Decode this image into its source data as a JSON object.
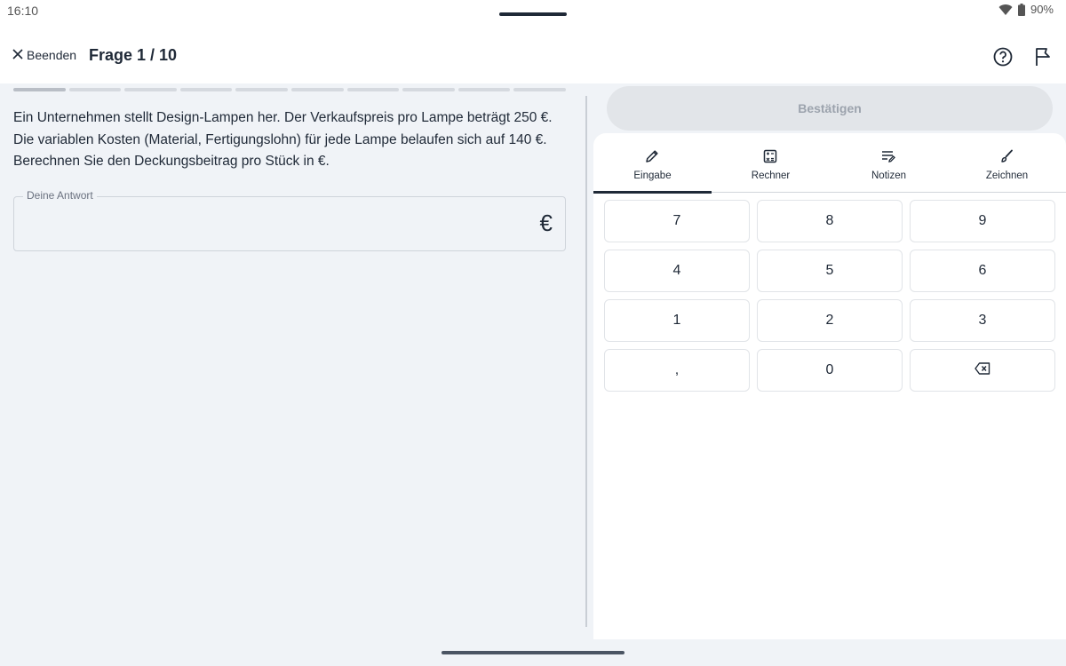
{
  "status": {
    "time": "16:10",
    "battery": "90%"
  },
  "header": {
    "close_label": "Beenden",
    "title": "Frage 1 / 10"
  },
  "progress": {
    "current": 1,
    "total": 10
  },
  "question": {
    "lines": [
      "Ein Unternehmen stellt Design-Lampen her. Der Verkaufspreis pro Lampe beträgt 250 €.",
      "Die variablen Kosten (Material, Fertigungslohn) für jede Lampe belaufen sich auf 140 €.",
      "Berechnen Sie den Deckungsbeitrag pro Stück in €."
    ]
  },
  "answer": {
    "label": "Deine Antwort",
    "value": "",
    "unit": "€"
  },
  "confirm_label": "Bestätigen",
  "tabs": [
    {
      "label": "Eingabe",
      "icon": "pencil-icon",
      "active": true
    },
    {
      "label": "Rechner",
      "icon": "calculator-icon",
      "active": false
    },
    {
      "label": "Notizen",
      "icon": "notes-icon",
      "active": false
    },
    {
      "label": "Zeichnen",
      "icon": "brush-icon",
      "active": false
    }
  ],
  "keypad": {
    "keys": [
      "7",
      "8",
      "9",
      "4",
      "5",
      "6",
      "1",
      "2",
      "3",
      ",",
      "0"
    ],
    "backspace_icon": "backspace-icon"
  }
}
